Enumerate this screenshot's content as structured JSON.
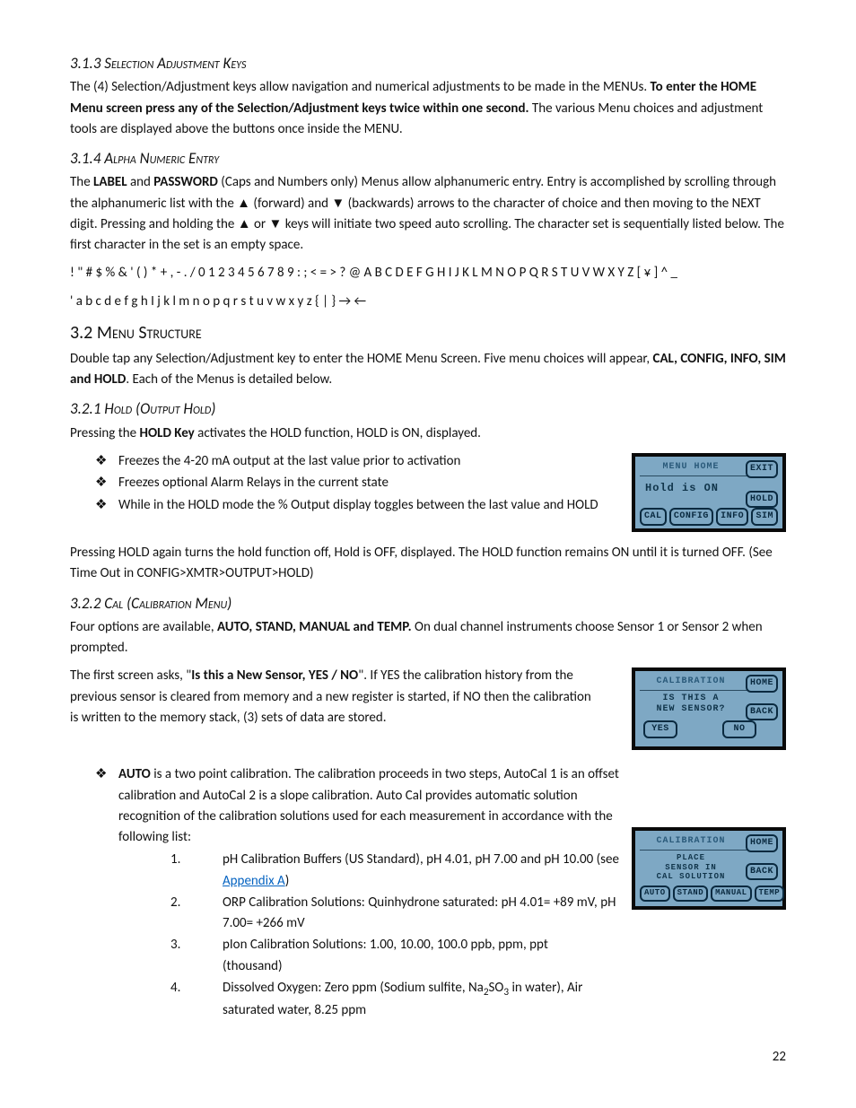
{
  "page_number": "22",
  "s313": {
    "heading": "3.1.3 Selection Adjustment Keys",
    "p1a": "The (4) Selection/Adjustment keys allow navigation and numerical adjustments to be made in the MENUs. ",
    "p1b": "To enter the HOME Menu screen press any of the Selection/Adjustment keys twice within one second.",
    "p1c": " The various Menu choices and adjustment tools are displayed above the buttons once inside the MENU."
  },
  "s314": {
    "heading": "3.1.4 Alpha Numeric Entry",
    "p1a": "The ",
    "p1b": "LABEL",
    "p1c": " and ",
    "p1d": "PASSWORD",
    "p1e": " (Caps and Numbers only) Menus allow alphanumeric entry. Entry is accomplished by scrolling through the alphanumeric list with the ▲ (forward) and ▼ (backwards) arrows to the character of choice and then moving to the NEXT digit. Pressing and holding the ▲ or ▼ keys will initiate two speed auto scrolling. The character set is sequentially listed below.  The first character in the set is an empty space.",
    "charset1": "  ! \" # $ % & ' ( ) * + , - . / 0 1 2 3 4 5 6 7 8 9 : ; < = > ? @ A B C D E F G H I J K L M N O P Q R S T U V W X Y Z [ ¥ ] ^ _",
    "charset2": "' a b c d e f g h I j k l m n o p q r s t u v w x y z { | } → ←"
  },
  "s32": {
    "heading": "3.2 Menu Structure",
    "p1a": "Double tap any Selection/Adjustment key to enter the HOME Menu Screen. Five menu choices will appear, ",
    "p1b": "CAL, CONFIG, INFO, SIM and HOLD",
    "p1c": ".  Each of the Menus is detailed below."
  },
  "s321": {
    "heading": "3.2.1 Hold (Output Hold)",
    "p1a": "Pressing the ",
    "p1b": "HOLD Key",
    "p1c": " activates the HOLD function, HOLD is ON, displayed.",
    "bullets": [
      "Freezes the 4-20 mA output at the last value prior to activation",
      "Freezes optional Alarm Relays in the current state",
      "While in the HOLD mode the % Output display toggles between the last value and HOLD"
    ],
    "p2": "Pressing HOLD again turns the hold function off, Hold is OFF, displayed. The HOLD function remains ON until it is turned OFF. (See Time Out in CONFIG>XMTR>OUTPUT>HOLD)",
    "lcd": {
      "title": "MENU HOME",
      "msg": "Hold is ON",
      "btn_exit": "EXIT",
      "btn_hold": "HOLD",
      "btn_cal": "CAL",
      "btn_config": "CONFIG",
      "btn_info": "INFO",
      "btn_sim": "SIM"
    }
  },
  "s322": {
    "heading": "3.2.2 Cal (Calibration Menu)",
    "p1a": "Four options are available, ",
    "p1b": "AUTO, STAND, MANUAL and TEMP.",
    "p1c": " On dual channel instruments choose Sensor 1 or Sensor 2 when prompted.",
    "p2a": "The first screen asks, \"",
    "p2b": "Is this a New Sensor, YES / NO",
    "p2c": "\". If YES the calibration history from the previous sensor is cleared from memory and a new register is started, if NO then the calibration is written to the memory stack, (3) sets of data are stored.",
    "auto_a": "AUTO",
    "auto_b": " is a two point calibration. The calibration proceeds in two steps, AutoCal 1 is an offset calibration and AutoCal 2 is a slope calibration. Auto Cal provides automatic solution recognition of the calibration solutions used for each measurement in accordance with the following list:",
    "items": {
      "i1a": "pH Calibration Buffers (US Standard), pH 4.01, pH 7.00 and pH 10.00 (see ",
      "i1link": "Appendix A",
      "i1b": ")",
      "i2": "ORP Calibration Solutions: Quinhydrone saturated:  pH 4.01= +89 mV,  pH 7.00= +266 mV",
      "i3": "pIon Calibration Solutions: 1.00, 10.00, 100.0 ppb, ppm, ppt (thousand)",
      "i4a": "Dissolved Oxygen: Zero ppm (Sodium sulfite, Na",
      "i4b": "SO",
      "i4c": " in water), Air saturated water, 8.25 ppm"
    },
    "lcd1": {
      "title": "CALIBRATION",
      "msg1": "IS THIS A",
      "msg2": "NEW SENSOR?",
      "btn_home": "HOME",
      "btn_back": "BACK",
      "btn_yes": "YES",
      "btn_no": "NO"
    },
    "lcd2": {
      "title": "CALIBRATION",
      "msg1": "PLACE",
      "msg2": "SENSOR IN",
      "msg3": "CAL SOLUTION",
      "btn_home": "HOME",
      "btn_back": "BACK",
      "btn_auto": "AUTO",
      "btn_stand": "STAND",
      "btn_manual": "MANUAL",
      "btn_temp": "TEMP"
    }
  }
}
